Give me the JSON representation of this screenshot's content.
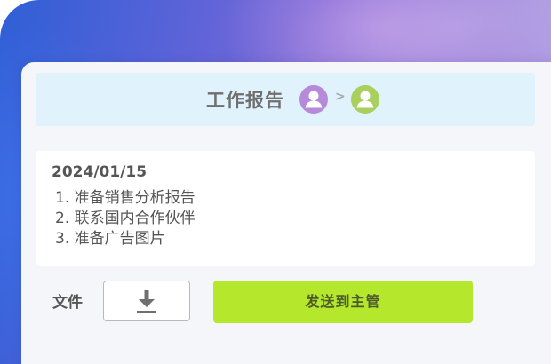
{
  "report": {
    "title": "工作报告",
    "flow_separator": ">",
    "sender_avatar": {
      "icon": "user-icon",
      "color": "#b58ad9"
    },
    "receiver_avatar": {
      "icon": "user-icon",
      "color": "#a9cf5c"
    }
  },
  "note": {
    "date": "2024/01/15",
    "items": [
      "1. 准备销售分析报告",
      "2. 联系国内合作伙伴",
      "3. 准备广告图片"
    ]
  },
  "attachments": {
    "label": "文件",
    "download_icon": "download-icon"
  },
  "actions": {
    "send_label": "发送到主管",
    "send_color": "#b5e82c"
  },
  "theme": {
    "header_bg": "#e0f2fb",
    "card_bg": "#f4f6f9"
  }
}
